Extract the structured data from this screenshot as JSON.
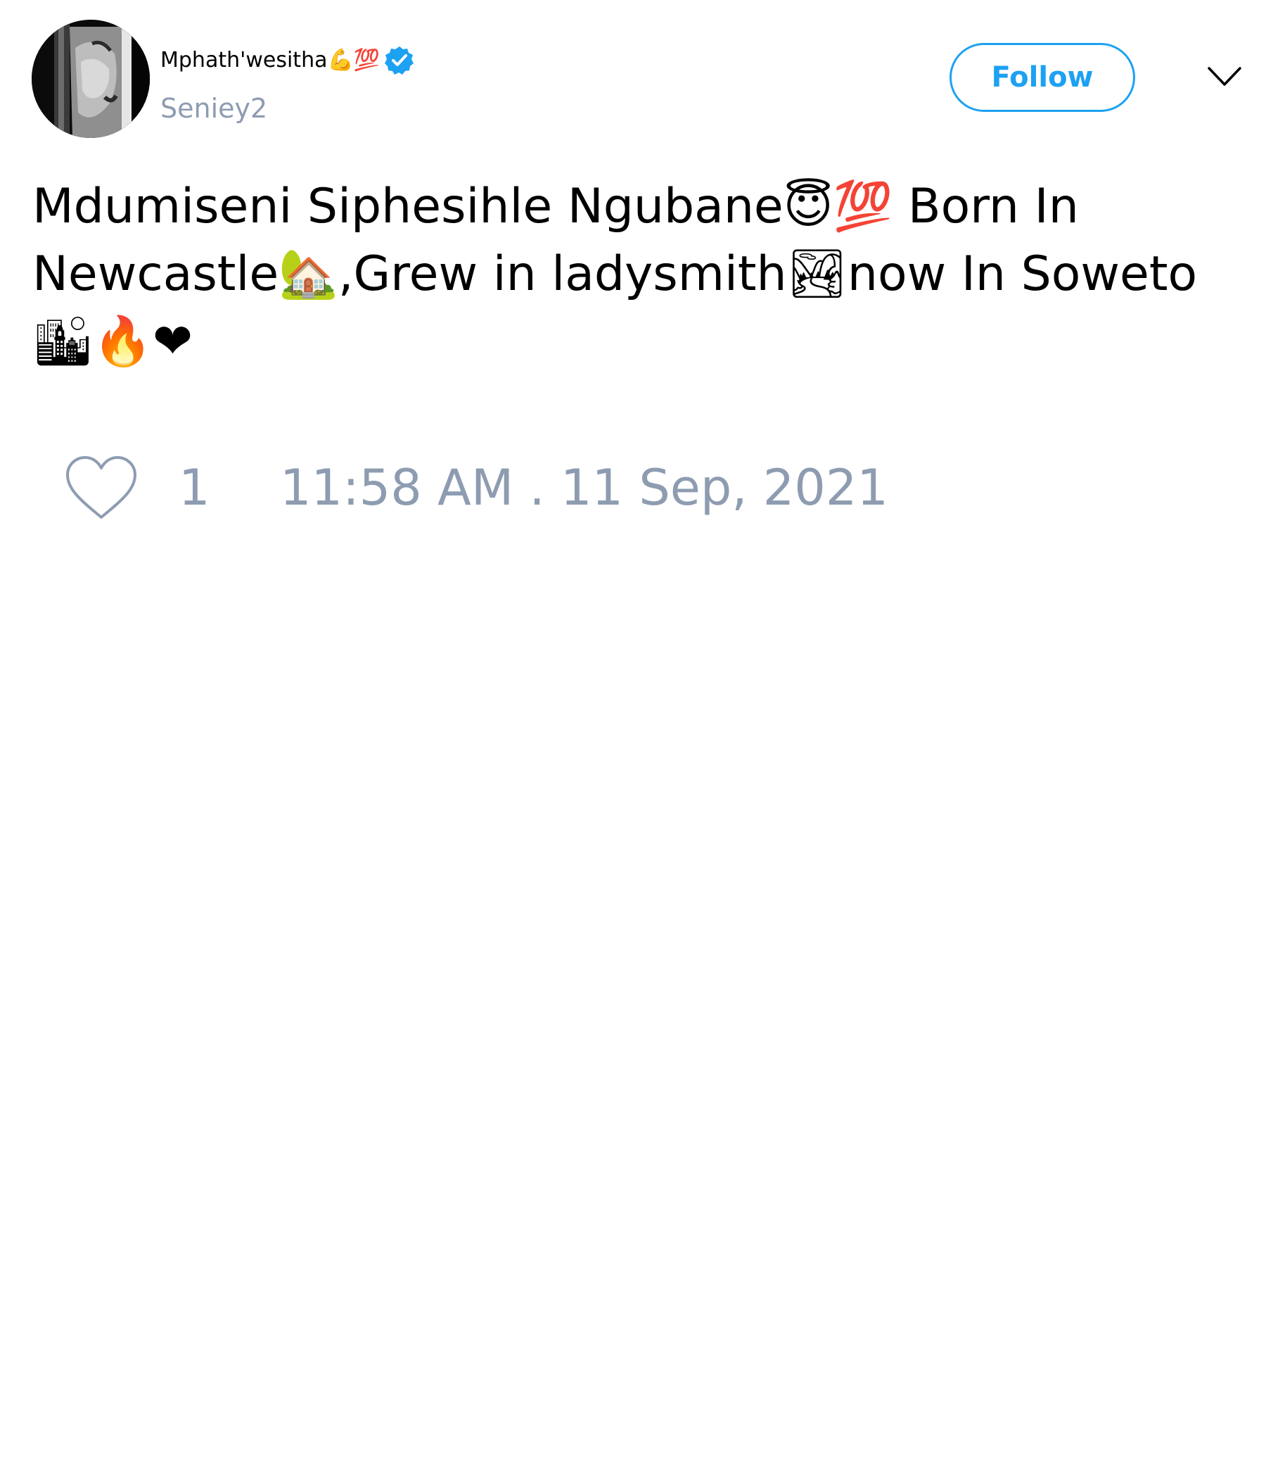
{
  "tweet": {
    "author": {
      "display_name": "Mphath'wesitha💪💯",
      "handle": "Seniey2",
      "verified": true,
      "avatar_icon": "profile-photo"
    },
    "follow_label": "Follow",
    "text": "Mdumiseni Siphesihle Ngubane😇💯 Born In Newcastle🏡,Grew in ladysmith🏞now In Soweto🏙🔥❤",
    "likes": "1",
    "timestamp": "11:58 AM . 11 Sep, 2021"
  },
  "colors": {
    "accent": "#1da1f2",
    "muted_text": "#8e9cb1",
    "text": "#000000",
    "background": "#ffffff"
  },
  "icons": {
    "verified": "verified-badge-icon",
    "menu": "chevron-down-icon",
    "like": "heart-icon"
  }
}
